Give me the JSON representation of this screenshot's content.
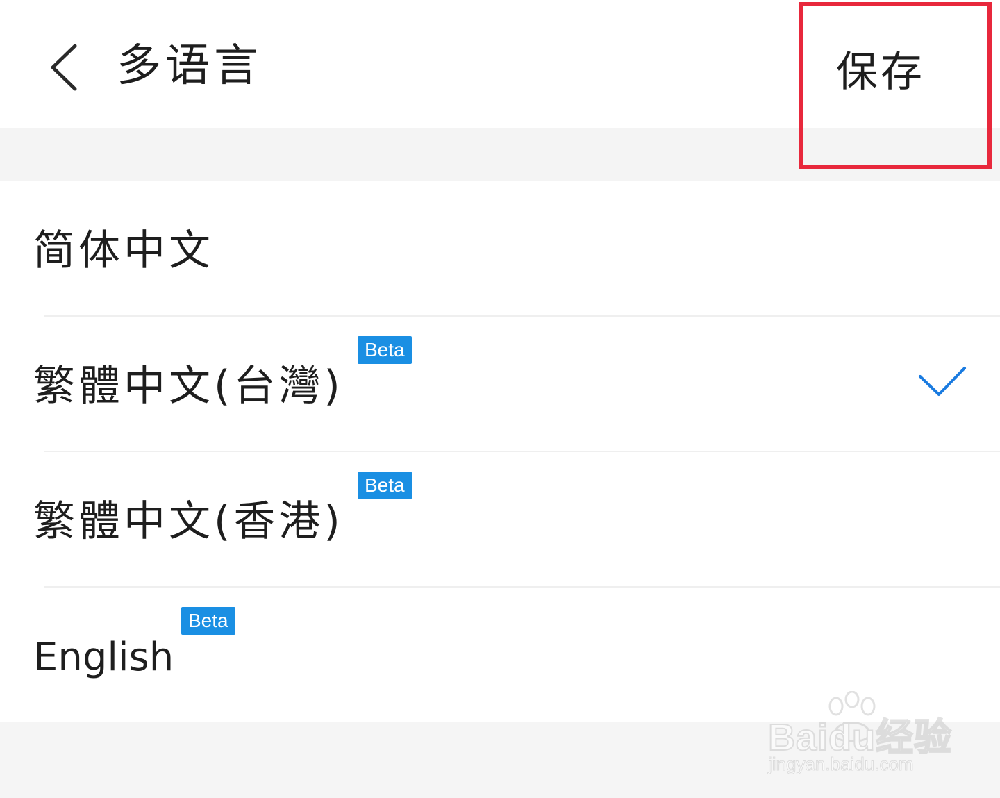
{
  "header": {
    "title": "多语言",
    "save_label": "保存",
    "back_icon": "chevron-left-icon",
    "highlight_color": "#e8283c"
  },
  "languages": [
    {
      "label": "简体中文",
      "beta": "",
      "selected": false
    },
    {
      "label": "繁體中文(台灣)",
      "beta": "Beta",
      "selected": true
    },
    {
      "label": "繁體中文(香港)",
      "beta": "Beta",
      "selected": false
    },
    {
      "label": "English",
      "beta": "Beta",
      "selected": false
    }
  ],
  "colors": {
    "accent": "#1a8fe3",
    "check": "#1a7be0",
    "background": "#f5f5f5",
    "surface": "#ffffff"
  },
  "watermark": {
    "brand": "Baidu经验",
    "url": "jingyan.baidu.com"
  }
}
